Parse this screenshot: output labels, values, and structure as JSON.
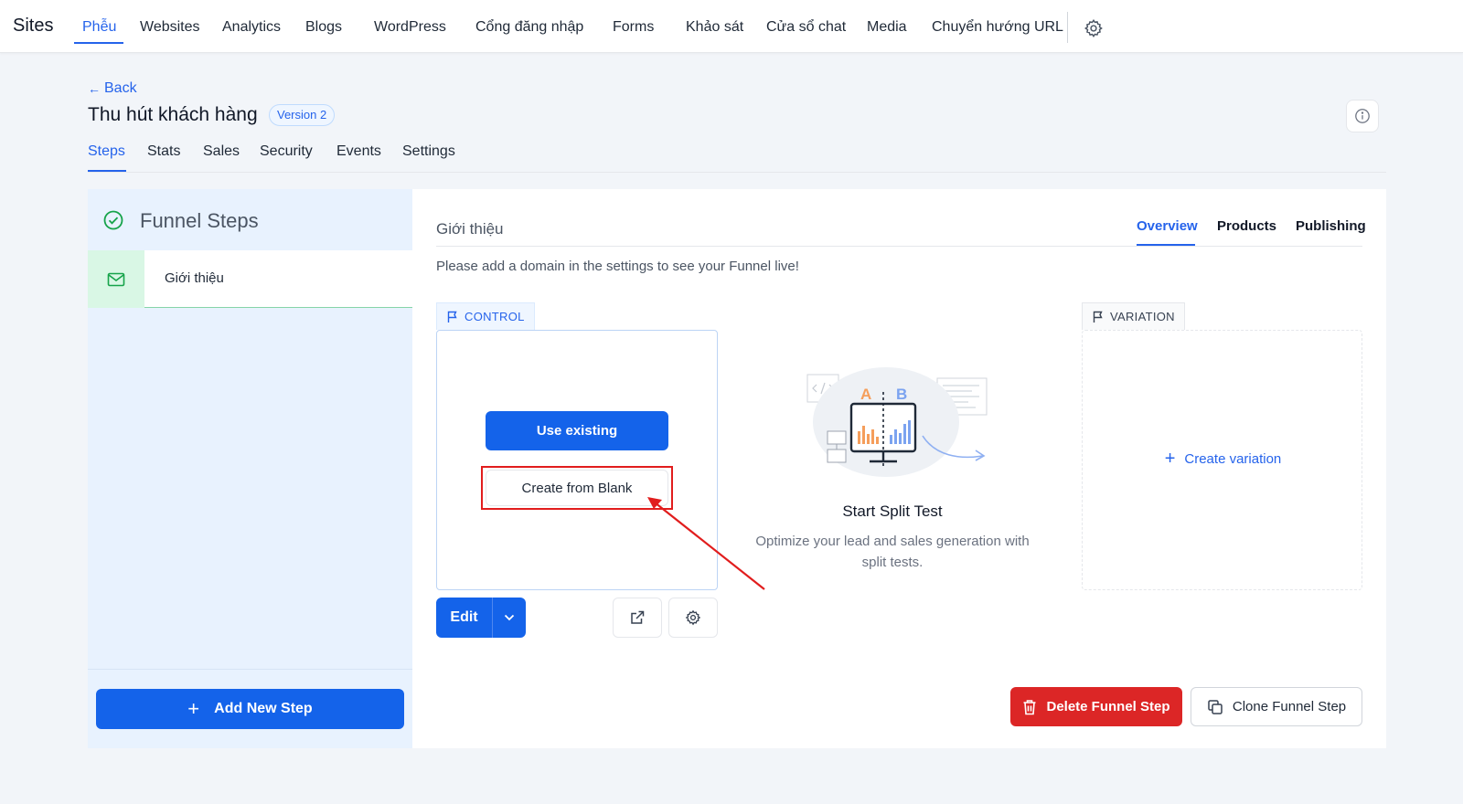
{
  "topnav": {
    "brand": "Sites",
    "items": [
      {
        "label": "Phễu",
        "active": true
      },
      {
        "label": "Websites"
      },
      {
        "label": "Analytics"
      },
      {
        "label": "Blogs"
      },
      {
        "label": "WordPress"
      },
      {
        "label": "Cổng đăng nhập"
      },
      {
        "label": "Forms"
      },
      {
        "label": "Khảo sát"
      },
      {
        "label": "Cửa sổ chat"
      },
      {
        "label": "Media"
      },
      {
        "label": "Chuyển hướng URL"
      }
    ]
  },
  "header": {
    "back_label": "Back",
    "title": "Thu hút khách hàng",
    "version_badge": "Version 2",
    "tabs": [
      {
        "label": "Steps",
        "active": true
      },
      {
        "label": "Stats"
      },
      {
        "label": "Sales"
      },
      {
        "label": "Security"
      },
      {
        "label": "Events"
      },
      {
        "label": "Settings"
      }
    ]
  },
  "sidebar": {
    "title": "Funnel Steps",
    "steps": [
      {
        "label": "Giới thiệu"
      }
    ],
    "add_step_label": "Add New Step"
  },
  "main": {
    "step_name": "Giới thiệu",
    "tabs": [
      {
        "label": "Overview",
        "active": true
      },
      {
        "label": "Products"
      },
      {
        "label": "Publishing"
      }
    ],
    "domain_message": "Please add a domain in the settings to see your Funnel live!",
    "control": {
      "tag": "CONTROL",
      "use_existing_label": "Use existing",
      "create_blank_label": "Create from Blank",
      "edit_label": "Edit"
    },
    "split_test": {
      "title": "Start Split Test",
      "description": "Optimize your lead and sales generation with split tests.",
      "illustration_letters": [
        "A",
        "B"
      ]
    },
    "variation": {
      "tag": "VARIATION",
      "create_label": "Create variation"
    },
    "delete_label": "Delete Funnel Step",
    "clone_label": "Clone Funnel Step"
  },
  "colors": {
    "accent": "#1463ea",
    "danger": "#dc2626",
    "annotation": "#e11d1d",
    "success": "#16a34a"
  }
}
